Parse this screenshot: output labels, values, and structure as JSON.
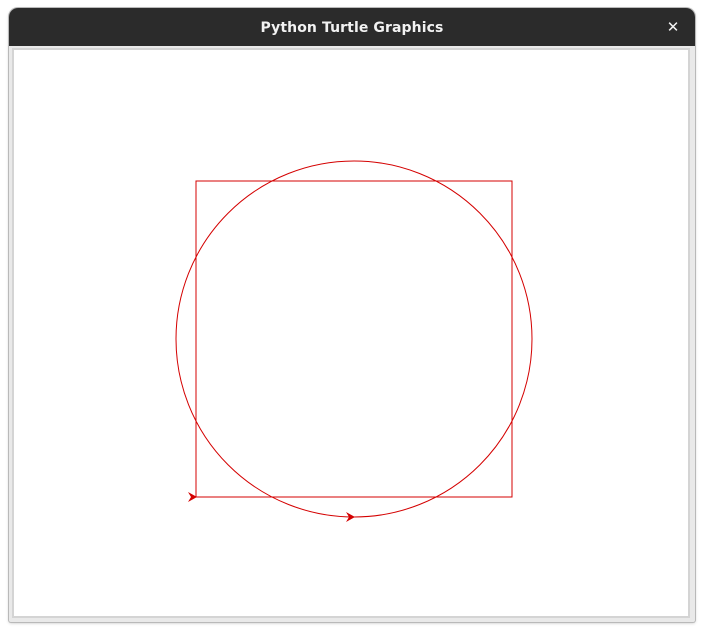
{
  "window": {
    "title": "Python Turtle Graphics",
    "close_glyph": "✕"
  },
  "drawing": {
    "pen_color": "#d40000",
    "shapes": [
      {
        "kind": "square",
        "side": 316
      },
      {
        "kind": "circle",
        "radius": 178
      }
    ],
    "turtles": [
      {
        "shape": "classic-arrow",
        "heading_deg": 0
      },
      {
        "shape": "classic-arrow",
        "heading_deg": 0
      }
    ]
  }
}
